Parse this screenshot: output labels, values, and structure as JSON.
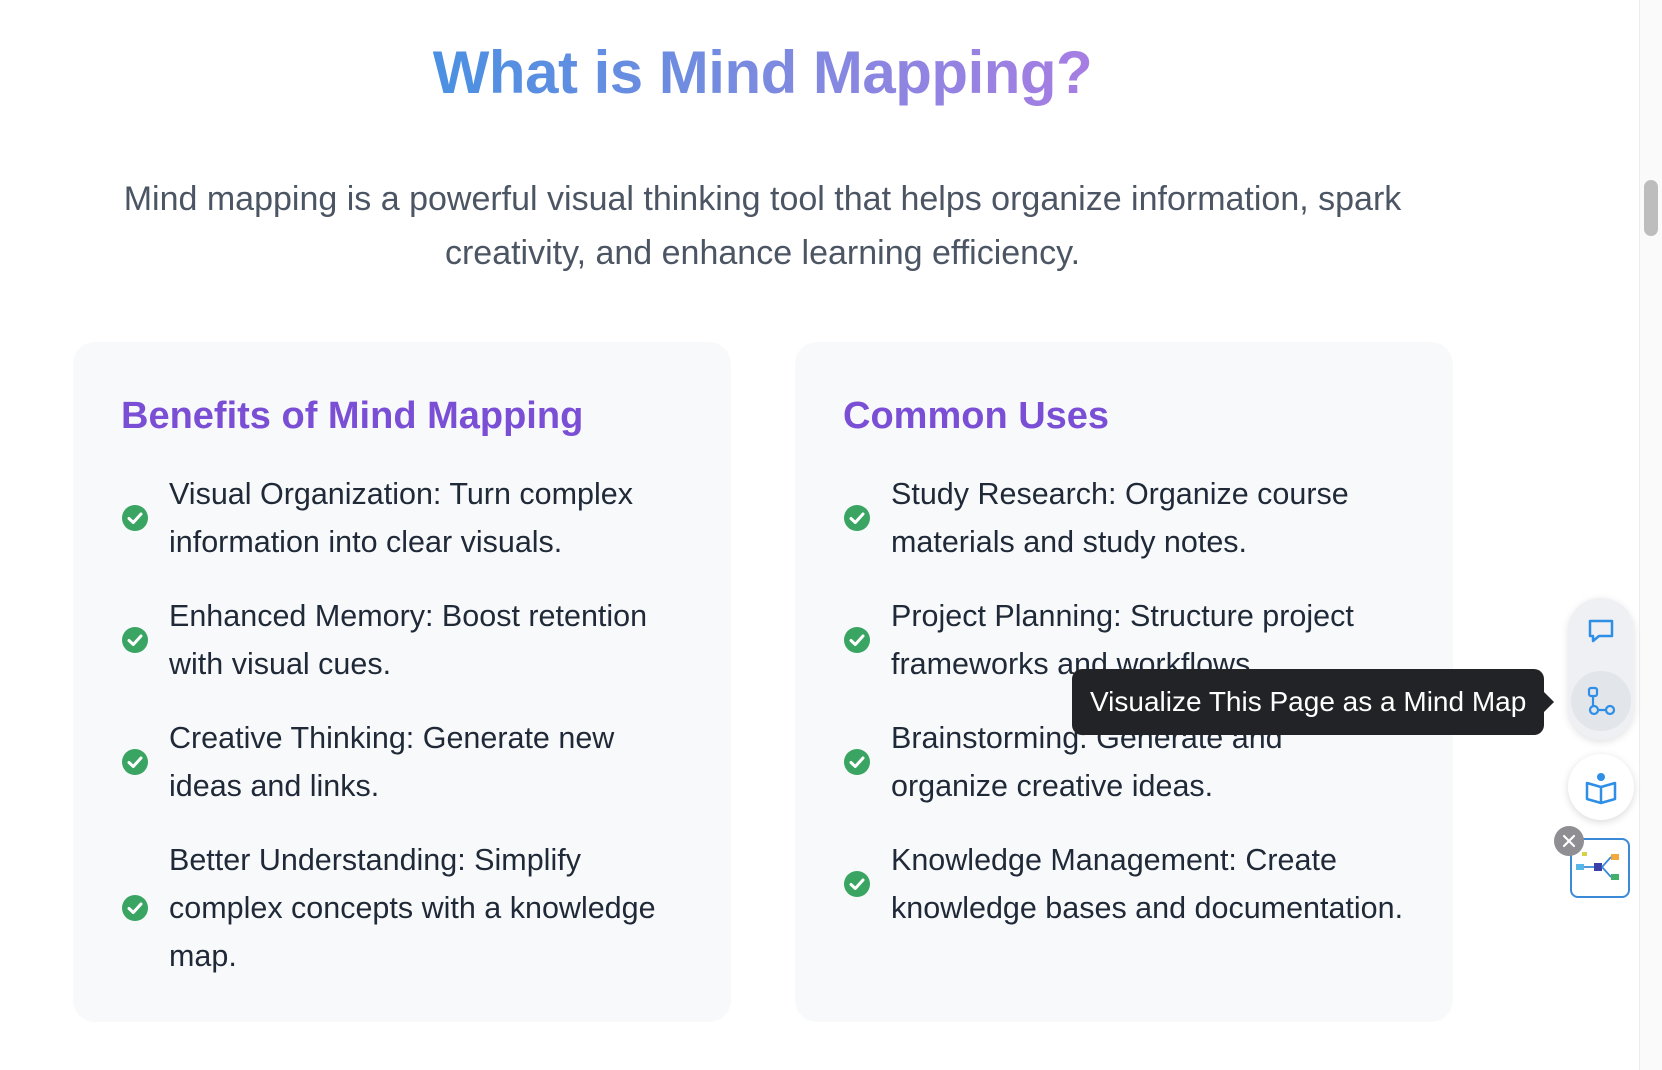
{
  "hero": {
    "title": "What is Mind Mapping?",
    "description": "Mind mapping is a powerful visual thinking tool that helps organize information, spark creativity, and enhance learning efficiency."
  },
  "benefits": {
    "title": "Benefits of Mind Mapping",
    "items": [
      "Visual Organization: Turn complex information into clear visuals.",
      "Enhanced Memory: Boost retention with visual cues.",
      "Creative Thinking: Generate new ideas and links.",
      "Better Understanding: Simplify complex concepts with a knowledge map."
    ]
  },
  "uses": {
    "title": "Common Uses",
    "items": [
      "Study Research: Organize course materials and study notes.",
      "Project Planning: Structure project frameworks and workflows.",
      "Brainstorming: Generate and organize creative ideas.",
      "Knowledge Management: Create knowledge bases and documentation."
    ]
  },
  "toolbar": {
    "tooltip": "Visualize This Page as a Mind Map",
    "icons": [
      "chat-icon",
      "mind-map-icon",
      "reader-icon",
      "mini-map-icon",
      "close-icon"
    ]
  },
  "colors": {
    "heading_purple": "#7a4fd6",
    "check_green": "#3aa463",
    "gradient_start": "#4a90e2",
    "gradient_end": "#a77de3",
    "accent_blue": "#3b8ad9"
  }
}
